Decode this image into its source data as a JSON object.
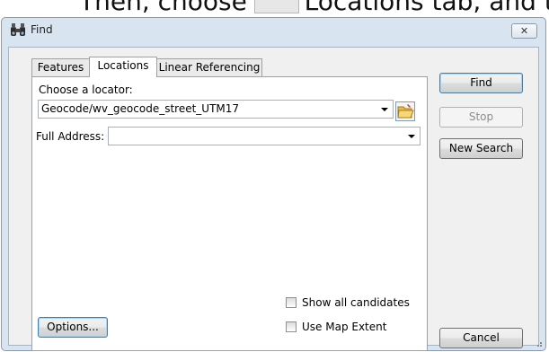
{
  "caption": {
    "text": "Then, choose the Locations tab, and the geocoding"
  },
  "window": {
    "title": "Find",
    "close_label": "✕"
  },
  "tabs": [
    {
      "label": "Features"
    },
    {
      "label": "Locations"
    },
    {
      "label": "Linear Referencing"
    }
  ],
  "locations": {
    "choose_locator_label": "Choose a locator:",
    "locator_value": "Geocode/wv_geocode_street_UTM17",
    "full_address_label": "Full Address:",
    "full_address_value": "",
    "show_all_candidates_label": "Show all candidates",
    "use_map_extent_label": "Use Map Extent",
    "options_label": "Options..."
  },
  "buttons": {
    "find": "Find",
    "stop": "Stop",
    "new_search": "New Search",
    "cancel": "Cancel"
  },
  "icons": {
    "window": "binoculars-icon",
    "browse": "folder-open-icon",
    "close": "close-icon",
    "dropdown": "chevron-down-icon"
  },
  "colors": {
    "frame": "#d9e4f1",
    "default_button_border": "#3c7fb1",
    "disabled_text": "#8d8d8d"
  }
}
